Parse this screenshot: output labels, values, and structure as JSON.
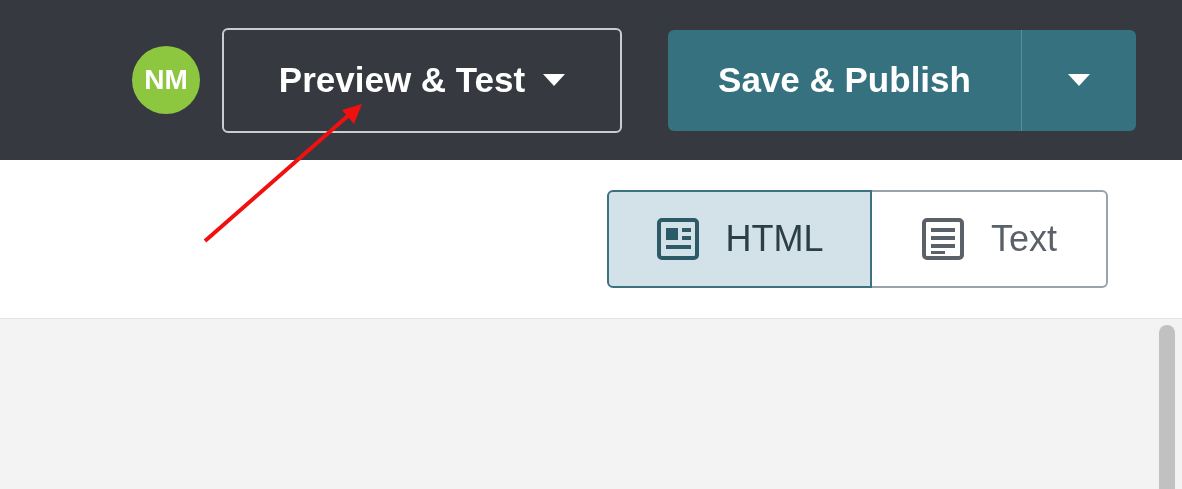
{
  "header": {
    "avatar": {
      "initials": "NM"
    },
    "preview_button": {
      "label": "Preview & Test"
    },
    "publish_button": {
      "label": "Save & Publish"
    }
  },
  "view_toggle": [
    {
      "label": "HTML",
      "kind": "layout",
      "selected": true
    },
    {
      "label": "Text",
      "kind": "lines",
      "selected": false
    }
  ]
}
